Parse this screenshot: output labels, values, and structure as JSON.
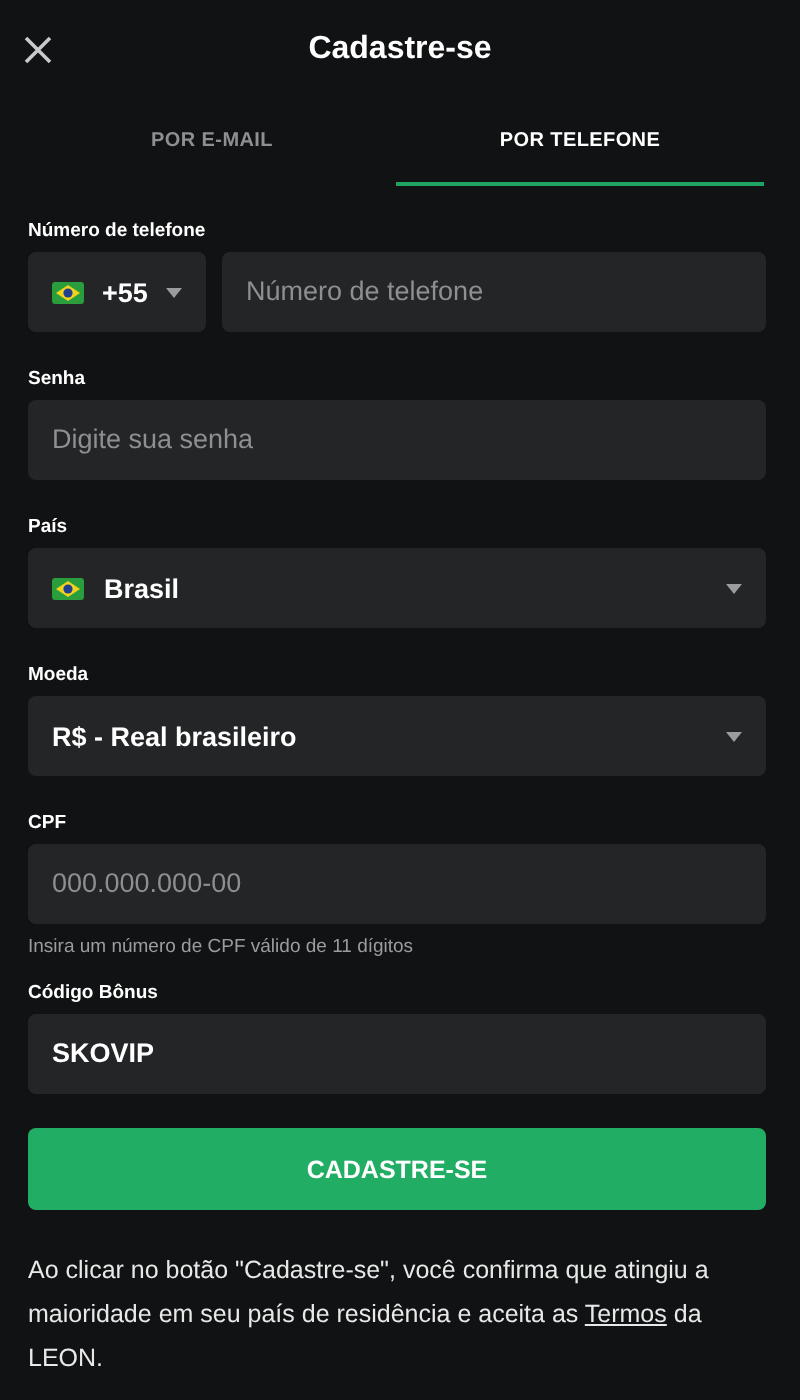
{
  "header": {
    "title": "Cadastre-se"
  },
  "tabs": [
    {
      "label": "POR E-MAIL",
      "selected": false
    },
    {
      "label": "POR TELEFONE",
      "selected": true
    }
  ],
  "fields": [
    {
      "kind": "phone",
      "label": "Número de telefone",
      "country_code": "+55",
      "placeholder": "Número de telefone"
    },
    {
      "kind": "text",
      "label": "Senha",
      "placeholder": "Digite sua senha"
    },
    {
      "kind": "country-select",
      "label": "País",
      "value": "Brasil"
    },
    {
      "kind": "select",
      "label": "Moeda",
      "value": "R$ - Real brasileiro"
    },
    {
      "kind": "text",
      "label": "CPF",
      "placeholder": "000.000.000-00",
      "hint": "Insira um número de CPF válido de 11 dígitos"
    },
    {
      "kind": "text",
      "label": "Código Bônus",
      "value": "SKOVIP"
    }
  ],
  "submit": {
    "label": "CADASTRE-SE"
  },
  "footer": {
    "text_before": "Ao clicar no botão \"Cadastre-se\", você confirma que atingiu a maioridade em seu país de residência e aceita as",
    "link": "Termos",
    "text_after": "da LEON."
  }
}
